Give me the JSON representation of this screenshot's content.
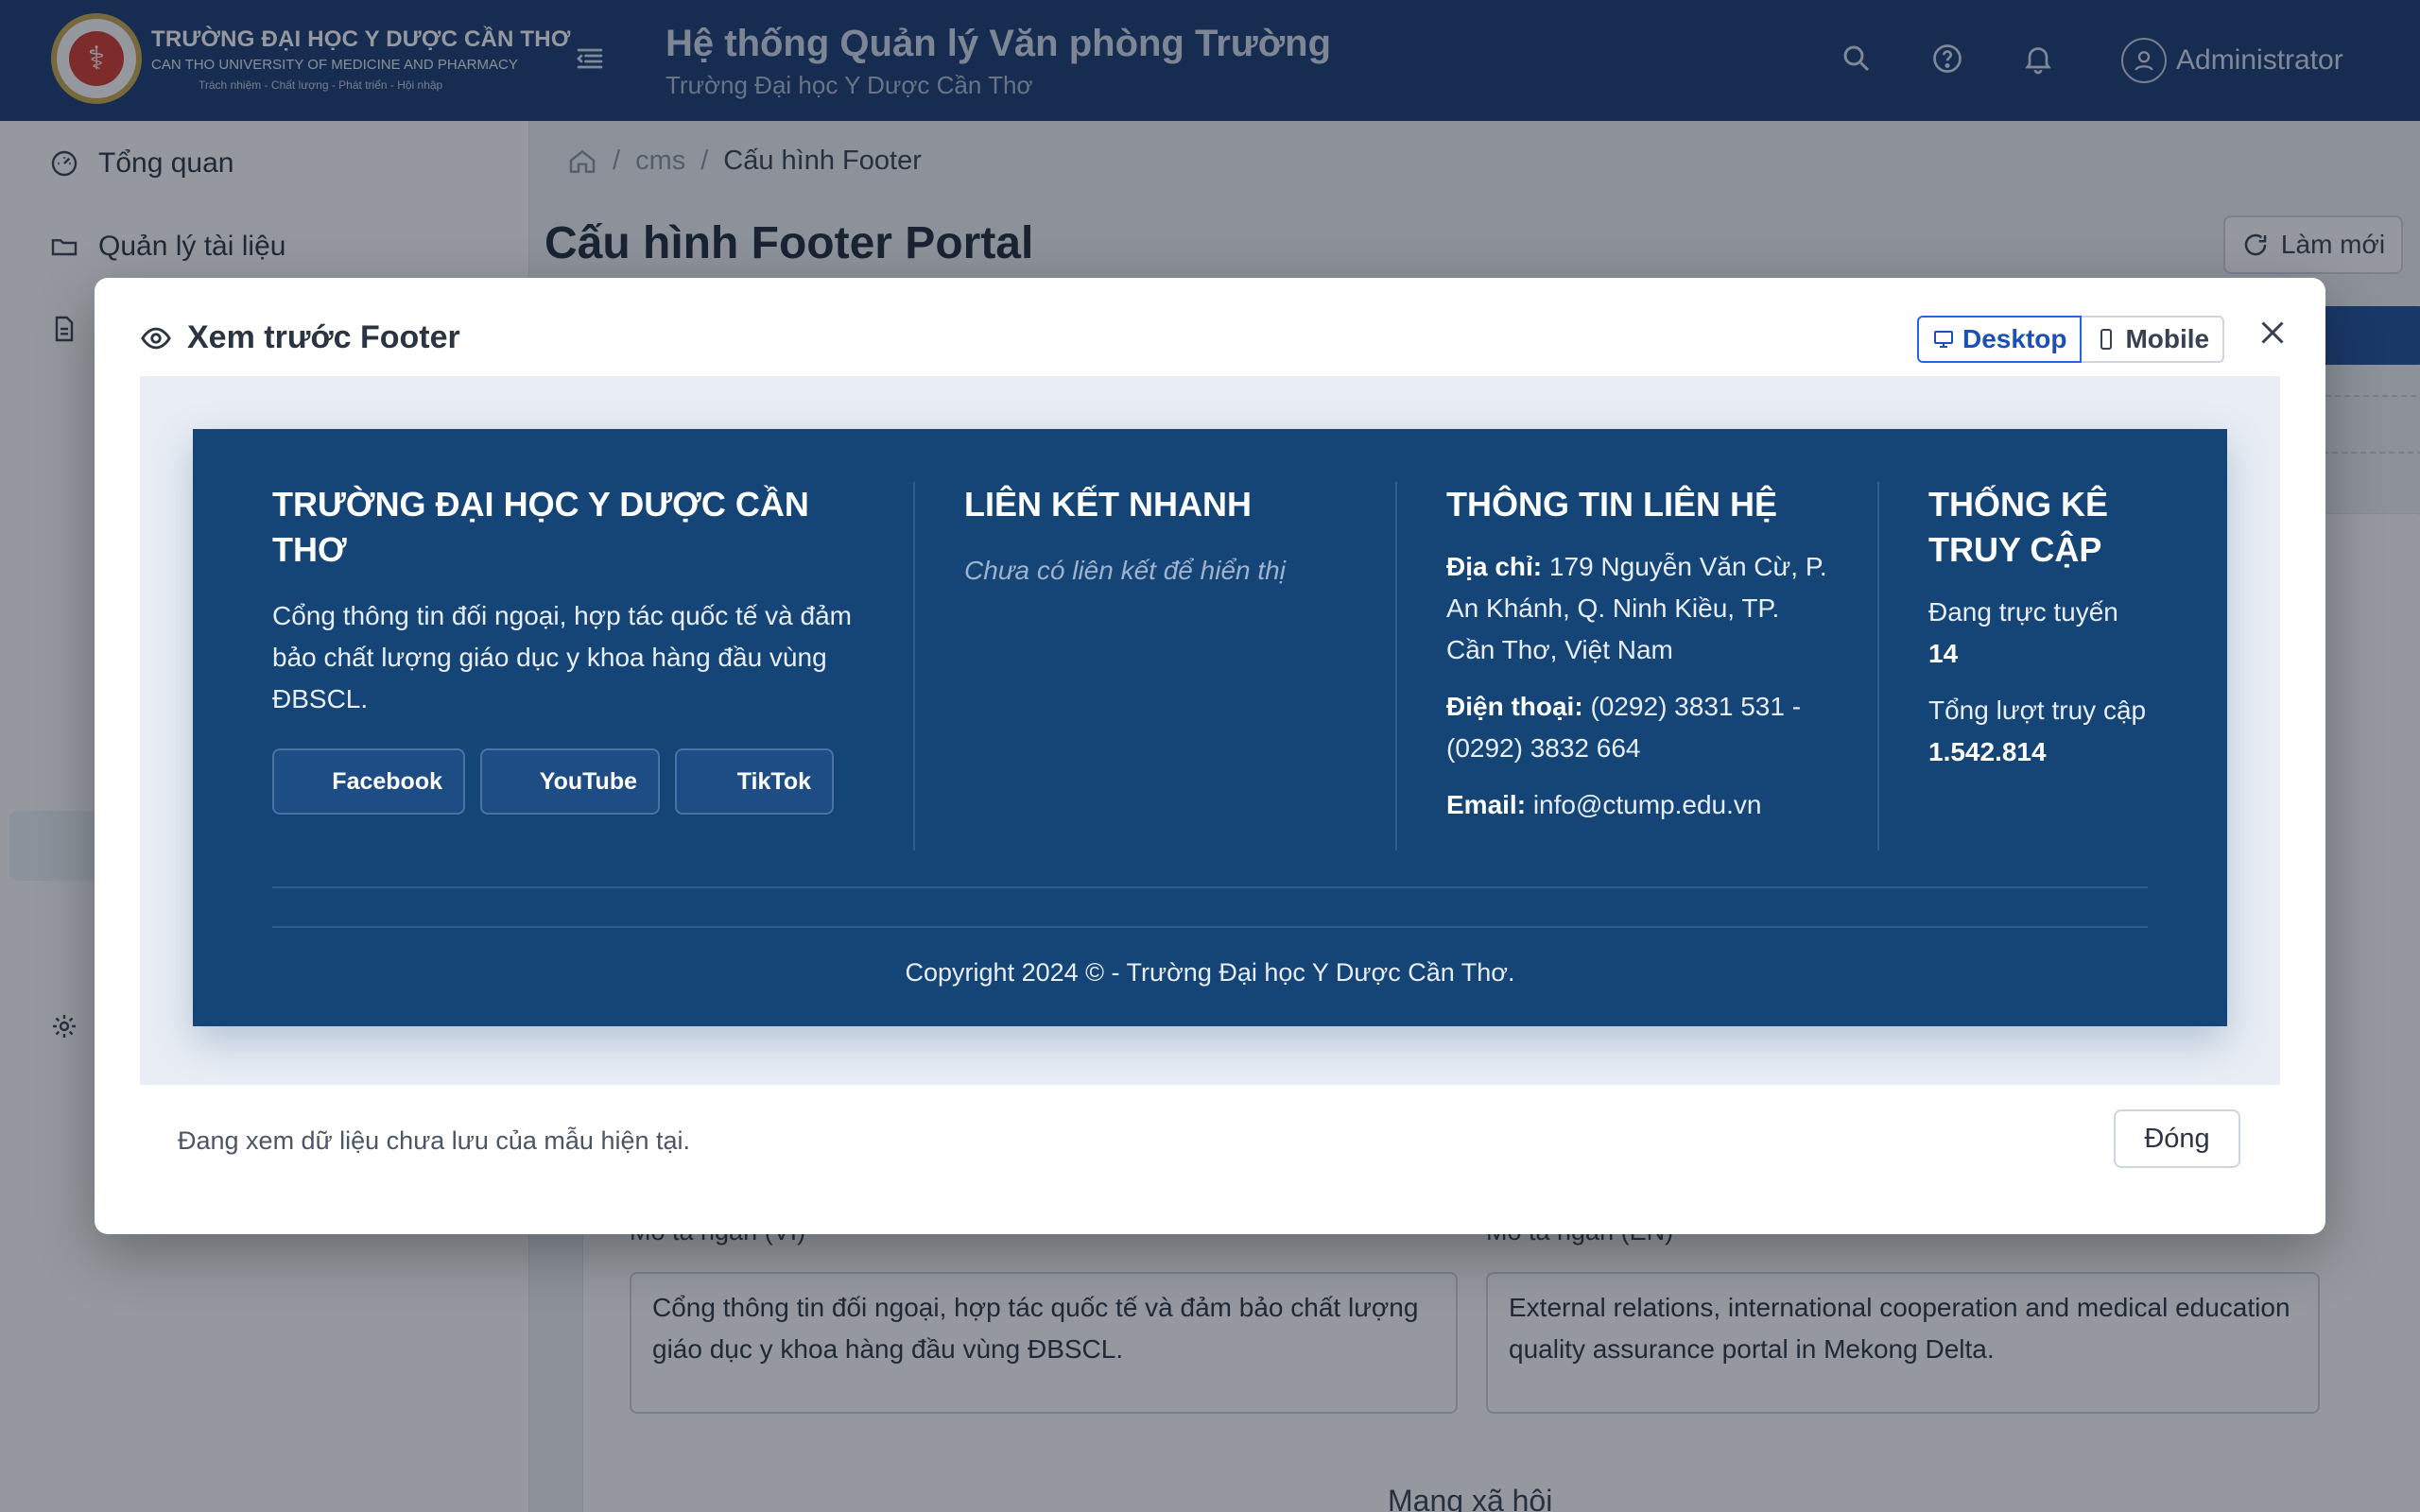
{
  "header": {
    "logo_line1": "TRƯỜNG ĐẠI HỌC Y DƯỢC CẦN THƠ",
    "logo_line2": "CAN THO UNIVERSITY OF MEDICINE AND PHARMACY",
    "logo_line3": "Trách nhiệm - Chất lượng - Phát triển - Hội nhập",
    "system_title": "Hệ thống Quản lý Văn phòng Trường",
    "system_subtitle": "Trường Đại học Y Dược Cần Thơ",
    "user_name": "Administrator"
  },
  "sidebar": {
    "items": [
      {
        "label": "Tổng quan",
        "icon": "dashboard-icon"
      },
      {
        "label": "Quản lý tài liệu",
        "icon": "folder-icon"
      },
      {
        "label": "",
        "icon": "document-icon"
      },
      {
        "label": "",
        "icon": "gear-icon"
      }
    ]
  },
  "breadcrumb": {
    "home_icon": "home-icon",
    "level1": "cms",
    "current": "Cấu hình Footer"
  },
  "page": {
    "title": "Cấu hình Footer Portal",
    "refresh_label": "Làm mới"
  },
  "form": {
    "desc_vi_label": "Mô tả ngắn (VI)",
    "desc_vi_value": "Cổng thông tin đối ngoại, hợp tác quốc tế và đảm bảo chất lượng giáo dục y khoa hàng đầu vùng ĐBSCL.",
    "desc_en_label": "Mô tả ngắn (EN)",
    "desc_en_value": "External relations, international cooperation and medical education quality assurance portal in Mekong Delta.",
    "section_social": "Mạng xã hội"
  },
  "modal": {
    "title": "Xem trước Footer",
    "toggle_desktop": "Desktop",
    "toggle_mobile": "Mobile",
    "note": "Đang xem dữ liệu chưa lưu của mẫu hiện tại.",
    "close_label": "Đóng"
  },
  "footer_preview": {
    "school_name": "TRƯỜNG ĐẠI HỌC Y DƯỢC CẦN THƠ",
    "school_desc": "Cổng thông tin đối ngoại, hợp tác quốc tế và đảm bảo chất lượng giáo dục y khoa hàng đầu vùng ĐBSCL.",
    "social": [
      "Facebook",
      "YouTube",
      "TikTok"
    ],
    "links_title": "LIÊN KẾT NHANH",
    "links_empty": "Chưa có liên kết để hiển thị",
    "contact_title": "THÔNG TIN LIÊN HỆ",
    "address_label": "Địa chỉ:",
    "address_value": "179 Nguyễn Văn Cừ, P. An Khánh, Q. Ninh Kiều, TP. Cần Thơ, Việt Nam",
    "phone_label": "Điện thoại:",
    "phone_value": "(0292) 3831 531 - (0292) 3832 664",
    "email_label": "Email:",
    "email_value": "info@ctump.edu.vn",
    "stats_title": "THỐNG KÊ TRUY CẬP",
    "online_label": "Đang trực tuyến",
    "online_value": "14",
    "total_label": "Tổng lượt truy cập",
    "total_value": "1.542.814",
    "copyright": "Copyright 2024 © - Trường Đại học Y Dược Cần Thơ."
  },
  "colors": {
    "header_bg": "#1b3a72",
    "footer_bg": "#154477",
    "accent": "#2563eb"
  }
}
